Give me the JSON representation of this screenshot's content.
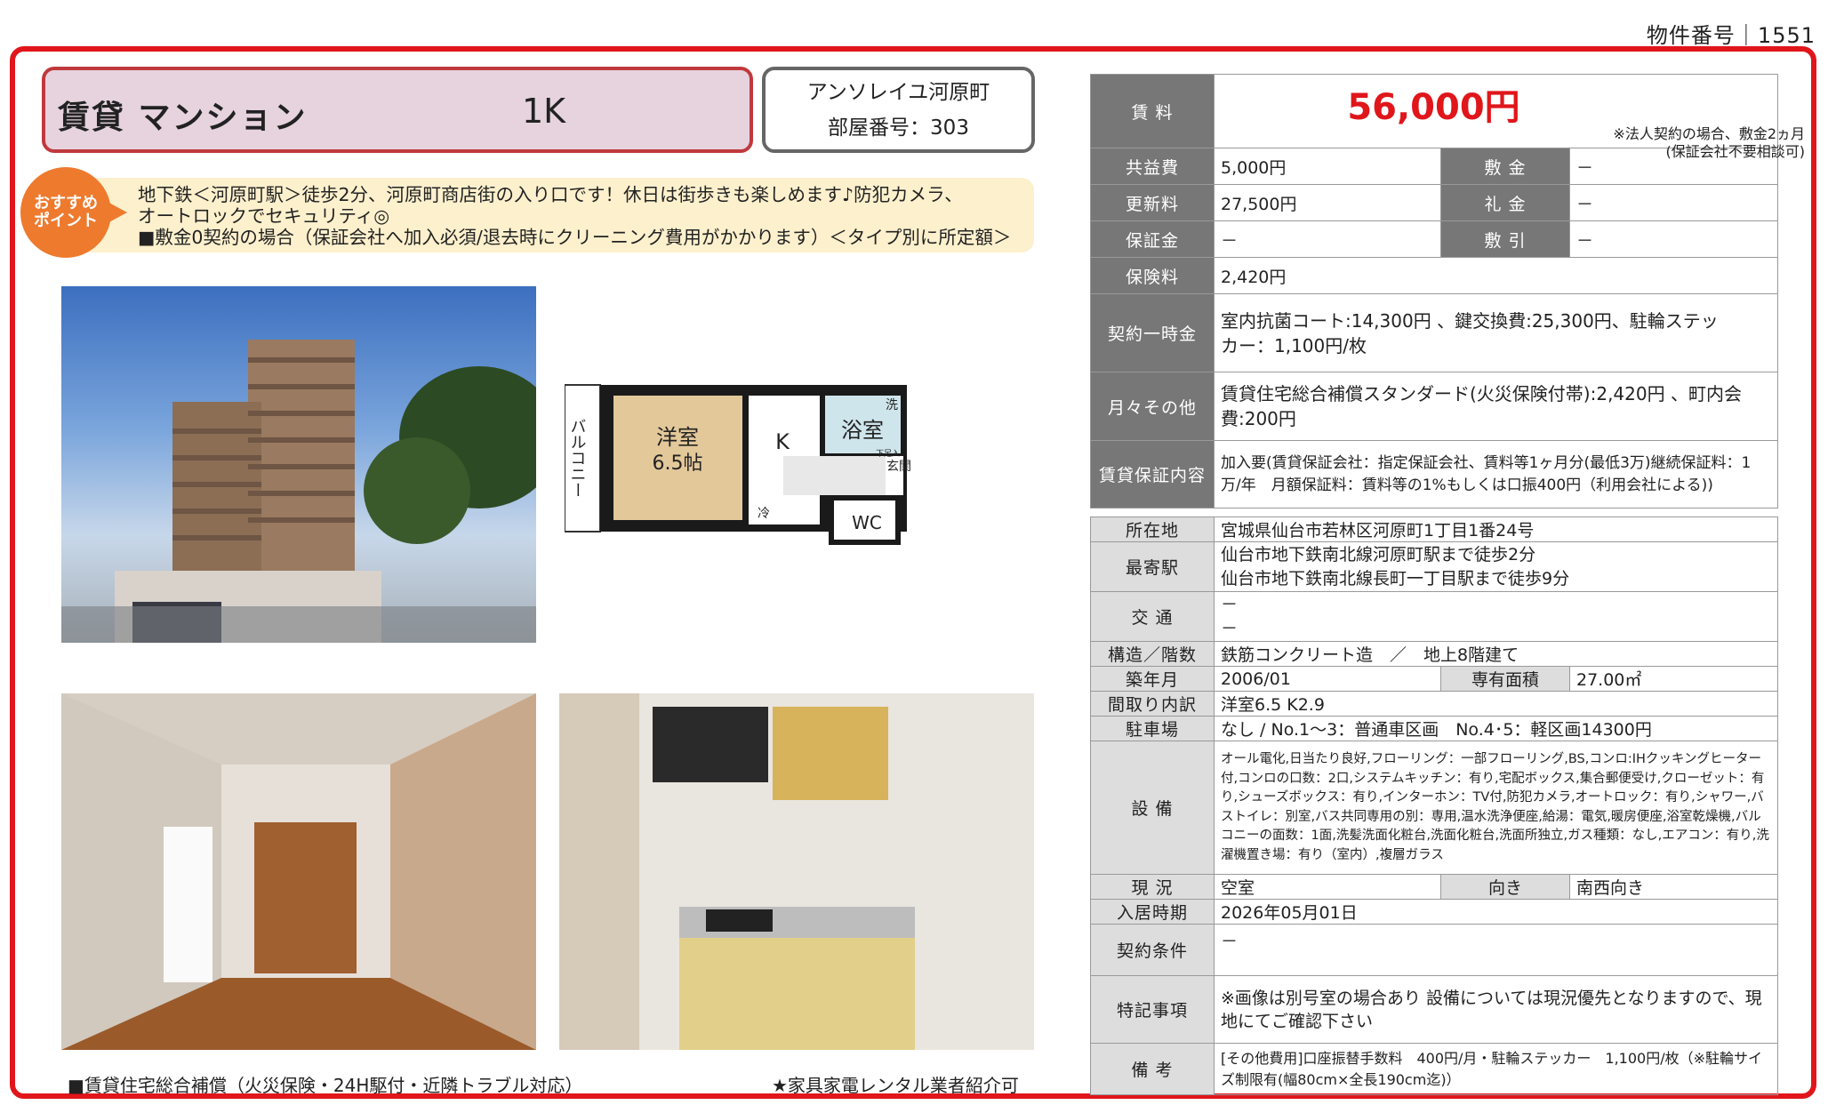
{
  "property_number_label": "物件番号｜1551",
  "header": {
    "type": "賃貸 マンション",
    "layout": "1K",
    "building_name": "アンソレイユ河原町",
    "room_number": "部屋番号：303"
  },
  "recommend": {
    "badge": "おすすめポイント",
    "line1": "地下鉄＜河原町駅＞徒歩2分、河原町商店街の入り口です！休日は街歩きも楽しめます♪防犯カメラ、",
    "line2": "オートロックでセキュリティ◎",
    "line3": "■敷金0契約の場合（保証会社へ加入必須/退去時にクリーニング費用がかかります）＜タイプ別に所定額＞"
  },
  "floorplan": {
    "balcony": "バルコニー",
    "western_room": "洋室",
    "western_size": "6.5帖",
    "kitchen": "K",
    "bath": "浴室",
    "wash": "洗",
    "fridge": "冷",
    "entrance": "玄関",
    "shoebox": "下足入",
    "wc": "WC"
  },
  "footer": {
    "left": "■賃貸住宅総合補償（火災保険・24H駆付・近隣トラブル対応）",
    "right": "★家具家電レンタル業者紹介可"
  },
  "rent": {
    "label": "賃 料",
    "value": "56,000円",
    "note1": "※法人契約の場合、敷金2ヵ月",
    "note2": "(保証会社不要相談可)"
  },
  "fees": {
    "common_label": "共益費",
    "common": "5,000円",
    "deposit_label": "敷 金",
    "deposit": "－",
    "renewal_label": "更新料",
    "renewal": "27,500円",
    "key_money_label": "礼 金",
    "key_money": "－",
    "guarantee_label": "保証金",
    "guarantee": "－",
    "amortization_label": "敷 引",
    "amortization": "－",
    "insurance_label": "保険料",
    "insurance": "2,420円",
    "onetime_label": "契約一時金",
    "onetime": "室内抗菌コート:14,300円 、鍵交換費:25,300円、駐輪ステッカー：1,100円/枚",
    "monthly_label": "月々その他",
    "monthly": "賃貸住宅総合補償スタンダード(火災保険付帯):2,420円 、町内会費:200円",
    "guarantor_label": "賃貸保証内容",
    "guarantor": "加入要(賃貸保証会社：指定保証会社、賃料等1ヶ月分(最低3万)継続保証料：1万/年　月額保証料：賃料等の1%もしくは口振400円（利用会社による))"
  },
  "details": {
    "address_label": "所在地",
    "address": "宮城県仙台市若林区河原町1丁目1番24号",
    "station_label": "最寄駅",
    "station1": "仙台市地下鉄南北線河原町駅まで徒歩2分",
    "station2": "仙台市地下鉄南北線長町一丁目駅まで徒歩9分",
    "transport_label": "交 通",
    "transport1": "－",
    "transport2": "－",
    "structure_label": "構造／階数",
    "structure": "鉄筋コンクリート造　／　地上8階建て",
    "built_label": "築年月",
    "built": "2006/01",
    "area_label": "専有面積",
    "area": "27.00㎡",
    "rooms_label": "間取り内訳",
    "rooms": "洋室6.5 K2.9",
    "parking_label": "駐車場",
    "parking": "なし / No.1～3：普通車区画　No.4･5：軽区画14300円",
    "equipment_label": "設 備",
    "equipment": "オール電化,日当たり良好,フローリング：一部フローリング,BS,コンロ:IHクッキングヒーター付,コンロの口数：2口,システムキッチン：有り,宅配ボックス,集合郵便受け,クローゼット：有り,シューズボックス：有り,インターホン：TV付,防犯カメラ,オートロック：有り,シャワー,バストイレ：別室,バス共同専用の別：専用,温水洗浄便座,給湯：電気,暖房便座,浴室乾燥機,バルコニーの面数：1面,洗髪洗面化粧台,洗面化粧台,洗面所独立,ガス種類：なし,エアコン：有り,洗濯機置き場：有り（室内）,複層ガラス",
    "status_label": "現 況",
    "status": "空室",
    "direction_label": "向き",
    "direction": "南西向き",
    "move_in_label": "入居時期",
    "move_in": "2026年05月01日",
    "conditions_label": "契約条件",
    "conditions": "－",
    "special_label": "特記事項",
    "special": "※画像は別号室の場合あり 設備については現況優先となりますので、現地にてご確認下さい",
    "remarks_label": "備 考",
    "remarks": "[その他費用]口座振替手数料　400円/月・駐輪ステッカー　1,100円/枚（※駐輪サイズ制限有(幅80cm×全長190cm迄)）"
  }
}
